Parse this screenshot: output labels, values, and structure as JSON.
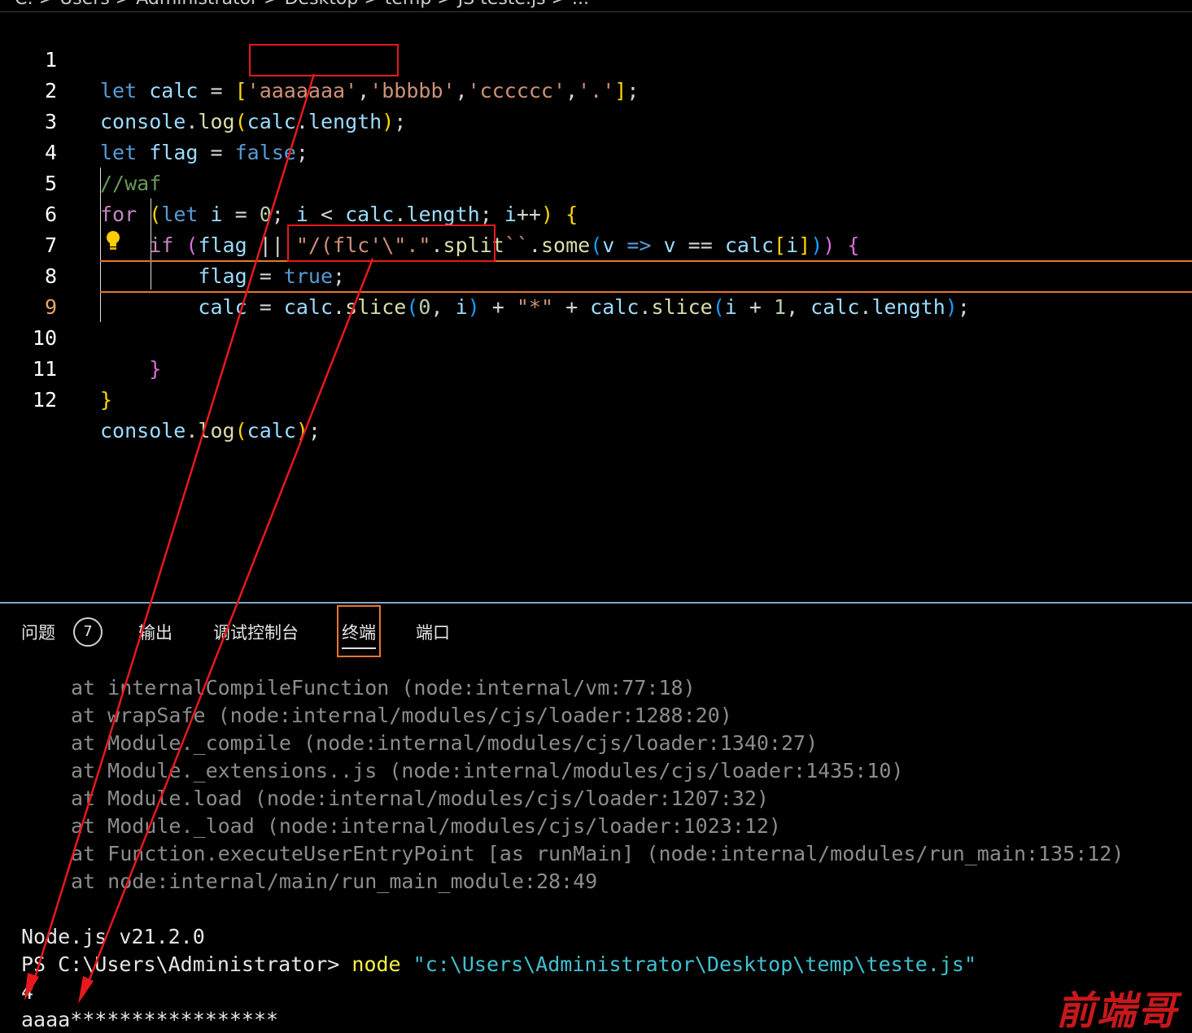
{
  "breadcrumb": {
    "text": "C: > Users > Administrator > Desktop > temp > JS teste.js > ..."
  },
  "editor": {
    "lines": [
      {
        "num": "1"
      },
      {
        "num": "2"
      },
      {
        "num": "3"
      },
      {
        "num": "4"
      },
      {
        "num": "5"
      },
      {
        "num": "6"
      },
      {
        "num": "7"
      },
      {
        "num": "8"
      },
      {
        "num": "9"
      },
      {
        "num": "10"
      },
      {
        "num": "11"
      },
      {
        "num": "12"
      }
    ],
    "code": {
      "l1": {
        "kw": "let",
        "var": "calc",
        "eq": " = ",
        "open": "[",
        "s1": "'aaaaaaa'",
        "c1": ",",
        "s2": "'bbbbb'",
        "c2": ",",
        "s3": "'cccccc'",
        "c3": ",",
        "s4": "'.'",
        "close": "]",
        "semi": ";"
      },
      "l2": {
        "obj": "console",
        "dot": ".",
        "fn": "log",
        "open": "(",
        "arg": "calc",
        "dot2": ".",
        "prop": "length",
        "close": ")",
        "semi": ";"
      },
      "l3": {
        "kw": "let",
        "var": "flag",
        "eq": " = ",
        "val": "false",
        "semi": ";"
      },
      "l4": {
        "comment": "//waf"
      },
      "l5": {
        "kw": "for",
        "open": "(",
        "kw2": "let",
        "var": "i",
        "eq": " = ",
        "num": "0",
        "semi": "; ",
        "var2": "i",
        "lt": " < ",
        "arr": "calc",
        "dot": ".",
        "prop": "length",
        "semi2": "; ",
        "var3": "i",
        "inc": "++",
        "close": ")",
        "brace": "{"
      },
      "l6": {
        "kw": "if",
        "open": "(",
        "var": "flag",
        "or": " || ",
        "str": "\"/(flc'\\\".\"",
        "dot": ".",
        "fn": "split",
        "tpl": "``",
        "dot2": ".",
        "fn2": "some",
        "open2": "(",
        "param": "v",
        "arrow": " => ",
        "param2": "v",
        "eqeq": " == ",
        "arr": "calc",
        "ob": "[",
        "idx": "i",
        "cb": "]",
        "close2": ")",
        "close": ")",
        "brace": "{"
      },
      "l7": {
        "var": "flag",
        "eq": " = ",
        "val": "true",
        "semi": ";"
      },
      "l8": {
        "var": "calc",
        "eq": " = ",
        "a1": "calc",
        "d1": ".",
        "f1": "slice",
        "o1": "(",
        "n1": "0",
        "cm1": ", ",
        "v1": "i",
        "c1": ")",
        "plus1": " + ",
        "star": "\"*\"",
        "plus2": " + ",
        "a2": "calc",
        "d2": ".",
        "f2": "slice",
        "o2": "(",
        "v2": "i",
        "plus3": " + ",
        "n2": "1",
        "cm2": ", ",
        "a3": "calc",
        "d3": ".",
        "p3": "length",
        "c2": ")",
        "semi": ";"
      },
      "l10": {
        "brace": "}"
      },
      "l11": {
        "brace": "}"
      },
      "l12": {
        "obj": "console",
        "dot": ".",
        "fn": "log",
        "open": "(",
        "arg": "calc",
        "close": ")",
        "semi": ";"
      }
    }
  },
  "panel": {
    "tabs": [
      {
        "label": "问题"
      },
      {
        "label": "输出"
      },
      {
        "label": "调试控制台"
      },
      {
        "label": "终端"
      },
      {
        "label": "端口"
      }
    ],
    "problems_count": "7",
    "active_tab": "终端"
  },
  "terminal": {
    "stack": [
      "at internalCompileFunction (node:internal/vm:77:18)",
      "at wrapSafe (node:internal/modules/cjs/loader:1288:20)",
      "at Module._compile (node:internal/modules/cjs/loader:1340:27)",
      "at Module._extensions..js (node:internal/modules/cjs/loader:1435:10)",
      "at Module.load (node:internal/modules/cjs/loader:1207:32)",
      "at Module._load (node:internal/modules/cjs/loader:1023:12)",
      "at Function.executeUserEntryPoint [as runMain] (node:internal/modules/run_main:135:12)",
      "at node:internal/main/run_main_module:28:49"
    ],
    "node_version": "Node.js v21.2.0",
    "prompt": "PS C:\\Users\\Administrator> ",
    "command": "node",
    "command_arg": " \"c:\\Users\\Administrator\\Desktop\\temp\\teste.js\"",
    "output1": "4",
    "output2": "aaaa*****************"
  },
  "watermark": {
    "text": "前端哥"
  },
  "colors": {
    "annotation_red": "#e8181c",
    "cursor_line": "#e8762d",
    "panel_border": "#7fa6c8"
  }
}
